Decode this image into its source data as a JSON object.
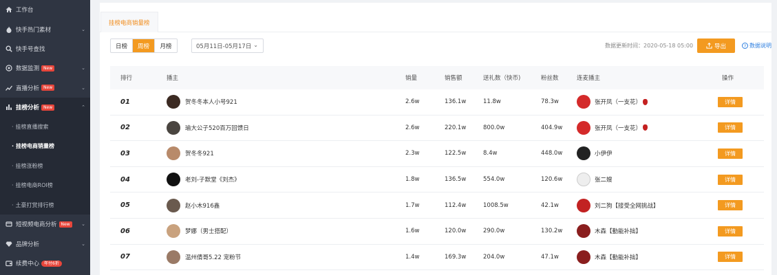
{
  "sidebar": {
    "items": [
      {
        "label": "工作台",
        "icon": "home-icon"
      },
      {
        "label": "快手热门素材",
        "icon": "fire-icon"
      },
      {
        "label": "快手号查找",
        "icon": "search-icon"
      },
      {
        "label": "数据监测",
        "icon": "monitor-icon",
        "badge": "New"
      },
      {
        "label": "直播分析",
        "icon": "trend-icon",
        "badge": "New"
      },
      {
        "label": "挂榜分析",
        "icon": "bar-chart-icon",
        "badge": "New"
      }
    ],
    "sub_items": [
      {
        "label": "挂榜直播搜索"
      },
      {
        "label": "挂榜电商销量榜"
      },
      {
        "label": "挂榜涨粉榜"
      },
      {
        "label": "挂榜电商ROI榜"
      },
      {
        "label": "土豪打赏排行榜"
      }
    ],
    "bottom_items": [
      {
        "label": "短视频电商分析",
        "icon": "cart-icon",
        "badge": "New"
      },
      {
        "label": "品牌分析",
        "icon": "diamond-icon"
      },
      {
        "label": "续费中心",
        "icon": "wallet-icon",
        "badge": "年付6折"
      }
    ]
  },
  "tab": {
    "label": "挂榜电商销量榜"
  },
  "toolbar": {
    "period_tabs": [
      "日榜",
      "周榜",
      "月榜"
    ],
    "date_range": "05月11日-05月17日",
    "updated_text": "数据更新时间：2020-05-18 05:00",
    "export_label": "导出",
    "help_label": "数据说明"
  },
  "table": {
    "headers": {
      "rank": "排行",
      "host": "播主",
      "sales": "销量",
      "amount": "销售额",
      "gift": "送礼数（快币)",
      "fans": "粉丝数",
      "link": "连麦播主",
      "op": "操作"
    },
    "detail_label": "详情",
    "rows": [
      {
        "rank": "01",
        "host": "贺冬冬本人小号921",
        "sales": "2.6w",
        "amount": "136.1w",
        "gift": "11.8w",
        "fans": "78.3w",
        "link": "张开凤（一支花）"
      },
      {
        "rank": "02",
        "host": "瑜大公子520百万回馈日",
        "sales": "2.6w",
        "amount": "220.1w",
        "gift": "800.0w",
        "fans": "404.9w",
        "link": "张开凤（一支花）"
      },
      {
        "rank": "03",
        "host": "贺冬冬921",
        "sales": "2.3w",
        "amount": "122.5w",
        "gift": "8.4w",
        "fans": "448.0w",
        "link": "小伊伊"
      },
      {
        "rank": "04",
        "host": "老刘-子默堂《刘杰》",
        "sales": "1.8w",
        "amount": "136.5w",
        "gift": "554.0w",
        "fans": "120.6w",
        "link": "张二嫂"
      },
      {
        "rank": "05",
        "host": "赵小木916鑫",
        "sales": "1.7w",
        "amount": "112.4w",
        "gift": "1008.5w",
        "fans": "42.1w",
        "link": "刘二狗【接受全网挑战】"
      },
      {
        "rank": "06",
        "host": "梦娜（男士搭配）",
        "sales": "1.6w",
        "amount": "120.0w",
        "gift": "290.0w",
        "fans": "130.2w",
        "link": "木森【勤能补拙】"
      },
      {
        "rank": "07",
        "host": "温州倩哥5.22 宠粉节",
        "sales": "1.4w",
        "amount": "169.3w",
        "gift": "204.0w",
        "fans": "47.1w",
        "link": "木森【勤能补拙】"
      }
    ]
  },
  "colors": {
    "accent": "#f39a20",
    "sidebar_bg": "#2f3542",
    "badge": "#e8463b",
    "link": "#2d7fe0"
  }
}
